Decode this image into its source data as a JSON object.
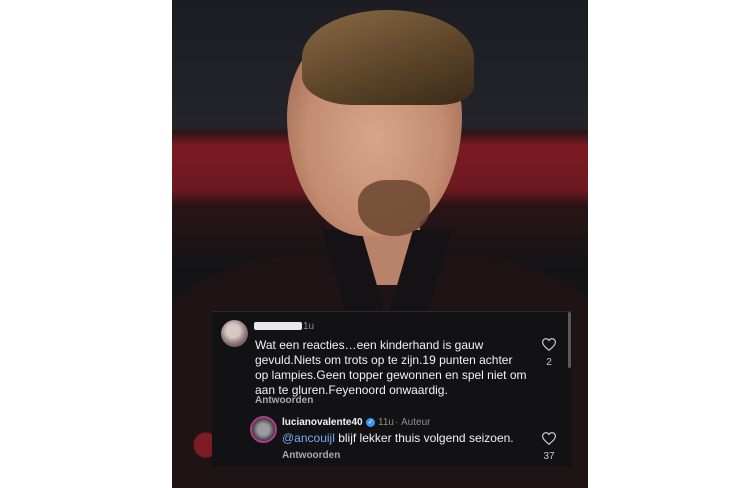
{
  "comments": [
    {
      "time": "1u",
      "text": "Wat een reacties…een kinderhand is gauw gevuld.Niets om trots op te zijn.19 punten achter op lampies.Geen topper gewonnen en spel niet om aan te gluren.Feyenoord onwaardig.",
      "lines": [
        "Wat een reacties…een kinderhand is gauw",
        "gevuld.Niets om trots op te zijn.19 punten achter",
        "op lampies.Geen topper gewonnen en spel niet om",
        "aan te gluren.Feyenoord onwaardig."
      ],
      "reply_label": "Antwoorden",
      "likes": "2"
    }
  ],
  "reply": {
    "username": "lucianovalente40",
    "time": "11u",
    "separator": "·",
    "author_badge": "Auteur",
    "mention": "@ancouijl",
    "text": " blijf lekker thuis volgend seizoen.",
    "reply_label": "Antwoorden",
    "likes": "37"
  },
  "icons": {
    "heart": "heart-icon",
    "verified": "verified-badge-icon"
  },
  "colors": {
    "panel_bg": "#121214",
    "mention": "#7aa7f5",
    "verified": "#3897f0"
  }
}
